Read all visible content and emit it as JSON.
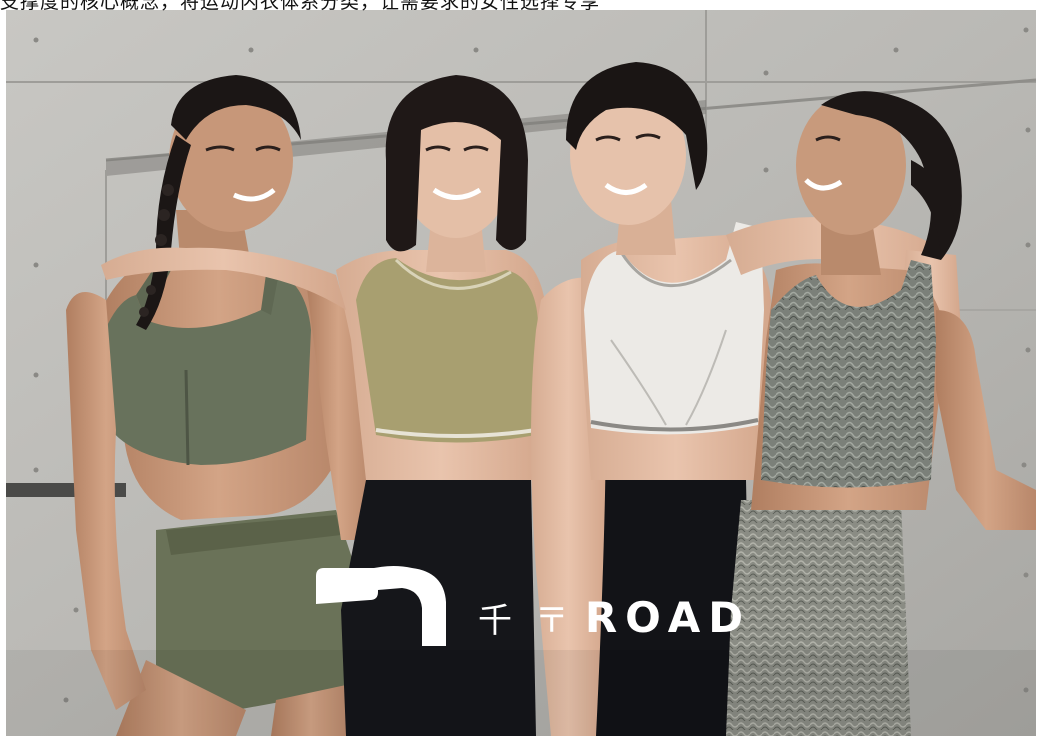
{
  "caption": {
    "text": "支撑度的核心概念，将运动内衣体系分类，让需要求的女性选择专享"
  },
  "photo": {
    "palette": {
      "wall": "#bdbcb8",
      "wall_dark": "#a9a8a4",
      "skin": "#c99a7d",
      "skin_dark": "#a87558",
      "hair": "#1b1615",
      "olive_top": "#68725c",
      "khaki_top": "#a89f70",
      "white_top": "#eceae6",
      "snake_top": "#7b8079",
      "black_legging": "#15161a",
      "olive_shorts": "#6a7258"
    }
  },
  "logo": {
    "brand_text": "ROAD",
    "prefix_glyphs": "千 〒",
    "color": "#ffffff"
  }
}
